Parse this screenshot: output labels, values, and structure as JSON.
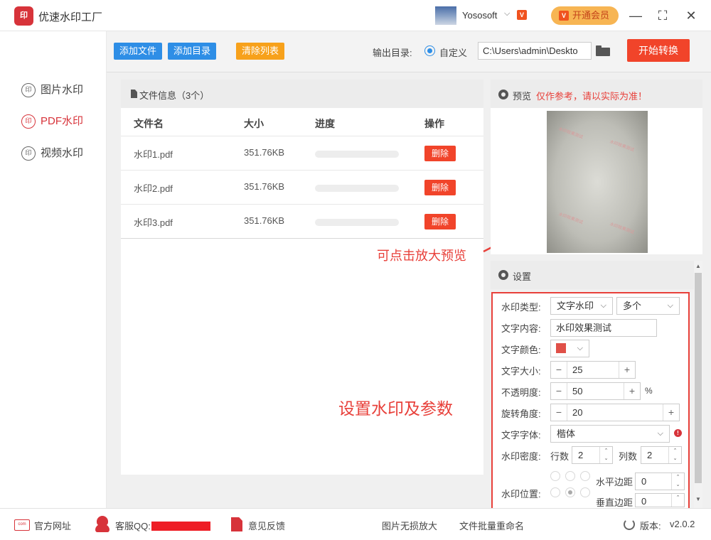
{
  "app": {
    "logo_text": "印",
    "title": "优速水印工厂"
  },
  "user": {
    "name": "Yososoft",
    "chevron": "⌵",
    "vip_badge": "V",
    "vip_button": "开通会员"
  },
  "window_controls": {
    "minimize": "—",
    "maximize": "⛶",
    "close": "✕"
  },
  "sidebar": {
    "items": [
      {
        "label": "图片水印",
        "icon": "印",
        "active": false
      },
      {
        "label": "PDF水印",
        "icon": "印",
        "active": true
      },
      {
        "label": "视频水印",
        "icon": "印",
        "active": false
      }
    ]
  },
  "toolbar": {
    "add_file": "添加文件",
    "add_folder": "添加目录",
    "clear_list": "清除列表",
    "output_label": "输出目录:",
    "output_option": "自定义",
    "output_path": "C:\\Users\\admin\\Deskto",
    "start": "开始转换"
  },
  "file_panel": {
    "title": "文件信息（3个）",
    "columns": [
      "文件名",
      "大小",
      "进度",
      "操作"
    ],
    "rows": [
      {
        "name": "水印1.pdf",
        "size": "351.76KB",
        "progress": 0,
        "action": "删除"
      },
      {
        "name": "水印2.pdf",
        "size": "351.76KB",
        "progress": 0,
        "action": "删除"
      },
      {
        "name": "水印3.pdf",
        "size": "351.76KB",
        "progress": 0,
        "action": "删除"
      }
    ]
  },
  "annotations": {
    "preview_hint": "可点击放大预览",
    "settings_hint": "设置水印及参数"
  },
  "preview": {
    "title": "预览",
    "warning": "仅作参考，请以实际为准！",
    "watermark_text": "水印效果测试"
  },
  "settings": {
    "title": "设置",
    "watermark_type_label": "水印类型:",
    "watermark_type": "文字水印",
    "watermark_count": "多个",
    "text_content_label": "文字内容:",
    "text_content": "水印效果测试",
    "text_color_label": "文字颜色:",
    "text_color": "#e05048",
    "text_size_label": "文字大小:",
    "text_size": "25",
    "opacity_label": "不透明度:",
    "opacity": "50",
    "opacity_unit": "%",
    "rotation_label": "旋转角度:",
    "rotation": "20",
    "font_label": "文字字体:",
    "font": "楷体",
    "font_alert": "!",
    "density_label": "水印密度:",
    "rows_label": "行数",
    "rows": "2",
    "cols_label": "列数",
    "cols": "2",
    "position_label": "水印位置:",
    "h_margin_label": "水平边距",
    "h_margin": "0",
    "v_margin_label": "垂直边距",
    "v_margin": "0",
    "stepper_minus": "−",
    "stepper_plus": "+",
    "spin_up": "⌃",
    "spin_down": "⌄",
    "chevron": "⌵"
  },
  "footer": {
    "website": "官方网址",
    "website_icon": "com",
    "qq": "客服QQ:",
    "feedback": "意见反馈",
    "lossless": "图片无损放大",
    "rename": "文件批量重命名",
    "version_label": "版本:",
    "version": "v2.0.2"
  }
}
